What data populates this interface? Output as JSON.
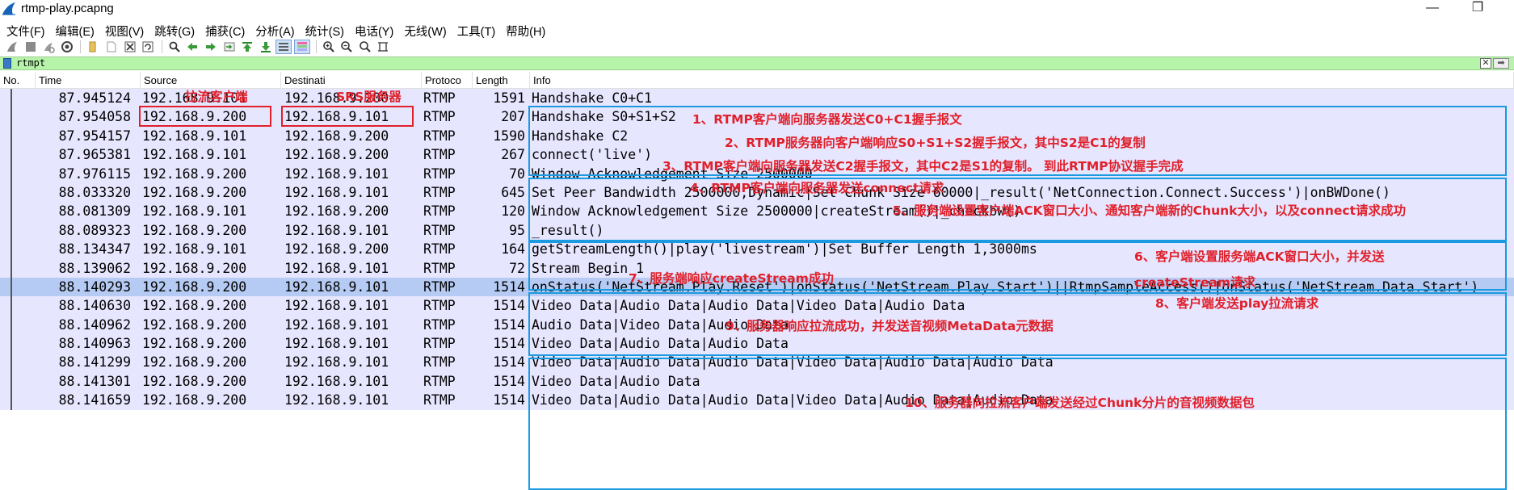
{
  "window": {
    "title": "rtmp-play.pcapng",
    "minimize_glyph": "—",
    "maximize_glyph": "❐"
  },
  "menu": [
    "文件(F)",
    "编辑(E)",
    "视图(V)",
    "跳转(G)",
    "捕获(C)",
    "分析(A)",
    "统计(S)",
    "电话(Y)",
    "无线(W)",
    "工具(T)",
    "帮助(H)"
  ],
  "toolbar": {
    "buttons": [
      "start-capture-icon",
      "stop-capture-icon",
      "restart-capture-icon",
      "capture-options-icon",
      "open-file-icon",
      "save-file-icon",
      "close-file-icon",
      "reload-file-icon",
      "find-packet-icon",
      "go-back-icon",
      "go-forward-icon",
      "go-to-packet-icon",
      "go-first-icon",
      "go-last-icon",
      "auto-scroll-icon",
      "colorize-icon",
      "zoom-in-icon",
      "zoom-out-icon",
      "zoom-normal-icon",
      "resize-columns-icon"
    ]
  },
  "filter": {
    "value": "rtmpt",
    "clear_glyph": "✕",
    "apply_glyph": "➡"
  },
  "columns": {
    "no": "No.",
    "time": "Time",
    "source": "Source",
    "destination": "Destinati",
    "protocol": "Protoco",
    "length": "Length",
    "info": "Info"
  },
  "packets": [
    {
      "time": "87.945124",
      "source": "192.168.9.101",
      "destination": "192.168.9.200",
      "protocol": "RTMP",
      "length": "1591",
      "info": "Handshake C0+C1"
    },
    {
      "time": "87.954058",
      "source": "192.168.9.200",
      "destination": "192.168.9.101",
      "protocol": "RTMP",
      "length": "207",
      "info": "Handshake S0+S1+S2"
    },
    {
      "time": "87.954157",
      "source": "192.168.9.101",
      "destination": "192.168.9.200",
      "protocol": "RTMP",
      "length": "1590",
      "info": "Handshake C2"
    },
    {
      "time": "87.965381",
      "source": "192.168.9.101",
      "destination": "192.168.9.200",
      "protocol": "RTMP",
      "length": "267",
      "info": "connect('live')"
    },
    {
      "time": "87.976115",
      "source": "192.168.9.200",
      "destination": "192.168.9.101",
      "protocol": "RTMP",
      "length": "70",
      "info": "Window Acknowledgement Size 2500000"
    },
    {
      "time": "88.033320",
      "source": "192.168.9.200",
      "destination": "192.168.9.101",
      "protocol": "RTMP",
      "length": "645",
      "info": "Set Peer Bandwidth 2500000,Dynamic|Set Chunk Size 60000|_result('NetConnection.Connect.Success')|onBWDone()"
    },
    {
      "time": "88.081309",
      "source": "192.168.9.101",
      "destination": "192.168.9.200",
      "protocol": "RTMP",
      "length": "120",
      "info": "Window Acknowledgement Size 2500000|createStream()|_checkbw()"
    },
    {
      "time": "88.089323",
      "source": "192.168.9.200",
      "destination": "192.168.9.101",
      "protocol": "RTMP",
      "length": "95",
      "info": "_result()"
    },
    {
      "time": "88.134347",
      "source": "192.168.9.101",
      "destination": "192.168.9.200",
      "protocol": "RTMP",
      "length": "164",
      "info": "getStreamLength()|play('livestream')|Set Buffer Length 1,3000ms"
    },
    {
      "time": "88.139062",
      "source": "192.168.9.200",
      "destination": "192.168.9.101",
      "protocol": "RTMP",
      "length": "72",
      "info": "Stream Begin 1"
    },
    {
      "time": "88.140293",
      "source": "192.168.9.200",
      "destination": "192.168.9.101",
      "protocol": "RTMP",
      "length": "1514",
      "info": "onStatus('NetStream.Play.Reset')|onStatus('NetStream.Play.Start')||RtmpSampleAccess()|onStatus('NetStream.Data.Start')",
      "selected": true
    },
    {
      "time": "88.140630",
      "source": "192.168.9.200",
      "destination": "192.168.9.101",
      "protocol": "RTMP",
      "length": "1514",
      "info": "Video Data|Audio Data|Audio Data|Video Data|Audio Data"
    },
    {
      "time": "88.140962",
      "source": "192.168.9.200",
      "destination": "192.168.9.101",
      "protocol": "RTMP",
      "length": "1514",
      "info": "Audio Data|Video Data|Audio Data"
    },
    {
      "time": "88.140963",
      "source": "192.168.9.200",
      "destination": "192.168.9.101",
      "protocol": "RTMP",
      "length": "1514",
      "info": "Video Data|Audio Data|Audio Data"
    },
    {
      "time": "88.141299",
      "source": "192.168.9.200",
      "destination": "192.168.9.101",
      "protocol": "RTMP",
      "length": "1514",
      "info": "Video Data|Audio Data|Audio Data|Video Data|Audio Data|Audio Data"
    },
    {
      "time": "88.141301",
      "source": "192.168.9.200",
      "destination": "192.168.9.101",
      "protocol": "RTMP",
      "length": "1514",
      "info": "Video Data|Audio Data"
    },
    {
      "time": "88.141659",
      "source": "192.168.9.200",
      "destination": "192.168.9.101",
      "protocol": "RTMP",
      "length": "1514",
      "info": "Video Data|Audio Data|Audio Data|Video Data|Audio Data|Audio Data"
    }
  ],
  "annotations": {
    "source_label": "拉流客户端",
    "destination_label": "SRS服务器",
    "a1": "1、RTMP客户端向服务器发送C0+C1握手报文",
    "a2": "2、RTMP服务器向客户端响应S0+S1+S2握手报文，其中S2是C1的复制",
    "a3": "3、RTMP客户端向服务器发送C2握手报文，其中C2是S1的复制。 到此RTMP协议握手完成",
    "a4": "4、RTMP客户端向服务器发送connect请求",
    "a5": "5、服务端设置客户端ACK窗口大小、通知客户端新的Chunk大小，以及connect请求成功",
    "a6_line1": "6、客户端设置服务端ACK窗口大小，并发送",
    "a6_line2": "createStream请求",
    "a7": "7、服务端响应createStream成功",
    "a8": "8、客户端发送play拉流请求",
    "a9": "9、服务器响应拉流成功，并发送音视频MetaData元数据",
    "a10": "10、服务器向拉流客户端发送经过Chunk分片的音视频数据包"
  },
  "colors": {
    "row_bg": "#e7e6ff",
    "selected_bg": "#b6cbf3",
    "filter_bg": "#b6f5a9",
    "annotation_red": "#e0202a",
    "annotation_blue": "#1a9ae0"
  }
}
